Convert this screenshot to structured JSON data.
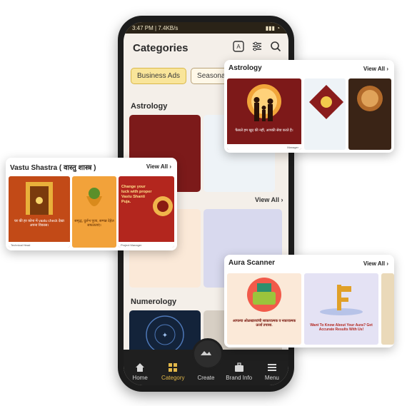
{
  "status": {
    "time_speed": "3:47 PM | 7.4KB/s"
  },
  "header": {
    "title": "Categories"
  },
  "chips": [
    "Business Ads",
    "Seasonal B"
  ],
  "sections": {
    "astrology": "Astrology",
    "view_all": "View All",
    "numerology": "Numerology"
  },
  "bottom_nav": [
    "Home",
    "Category",
    "Create",
    "Brand Info",
    "Menu"
  ],
  "popups": {
    "astrology": {
      "title": "Astrology",
      "view_all": "View All",
      "thumb1_text": "फैसले हम खुद की नहीं, आपकी सेवा करते है।",
      "thumb1_name": "Manager"
    },
    "vastu": {
      "title": "Vastu Shastra ( वास्तु शास्त्र )",
      "view_all": "View All",
      "thumb1_text": "घर की हर कोना में vastu check देखा अपना विकास।",
      "thumb1_name": "Technical Head",
      "thumb2_text": "समृद्ध, दुर्लभ पूजा, सम्पन्न देहेल सफलताएं।",
      "thumb3_text": "Change your luck with proper Vastu Shanti Puja.",
      "thumb3_name": "Project Manager"
    },
    "aura": {
      "title": "Aura Scanner",
      "view_all": "View All",
      "thumb1_text": "आपल्या ओळखाव्यांची साकारात्मक व नकारात्मक ऊर्जा तपासा.",
      "thumb2_text": "Want To Know About Your Aura? Get Accurate Results With Us!"
    }
  },
  "colors": {
    "accent": "#e2b84a",
    "maroon": "#7c1a1a"
  }
}
